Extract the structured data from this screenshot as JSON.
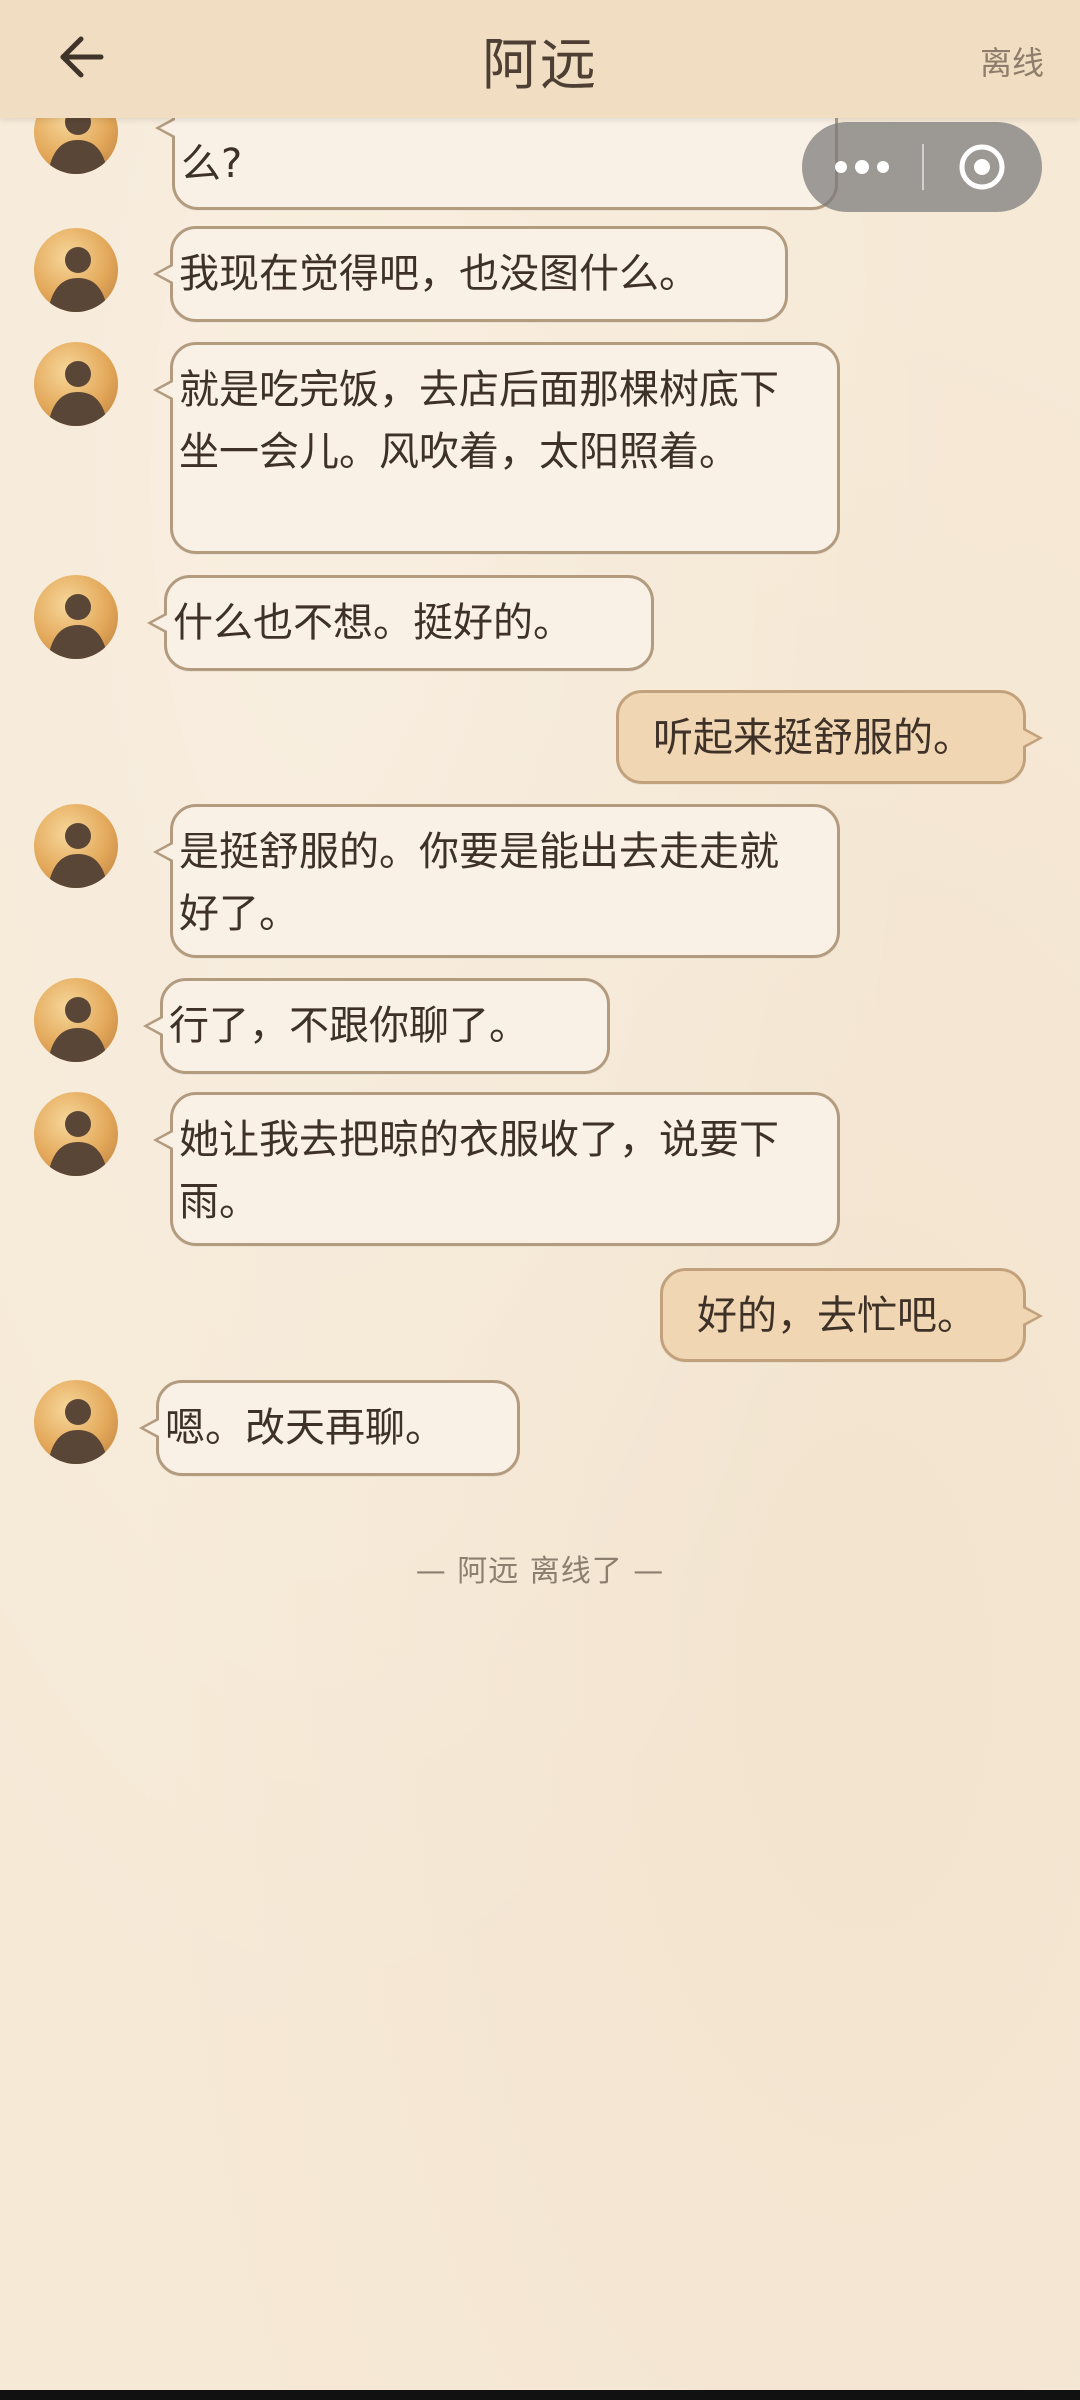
{
  "header": {
    "title": "阿远",
    "status": "离线"
  },
  "capsule": {
    "menu_icon": "more-dots-icon",
    "close_icon": "target-icon"
  },
  "messages": [
    {
      "side": "left",
      "text": "么?"
    },
    {
      "side": "left",
      "text": "我现在觉得吧，也没图什么。"
    },
    {
      "side": "left",
      "text": "就是吃完饭，去店后面那棵树底下坐一会儿。风吹着，太阳照着。"
    },
    {
      "side": "left",
      "text": "什么也不想。挺好的。"
    },
    {
      "side": "right",
      "text": "听起来挺舒服的。"
    },
    {
      "side": "left",
      "text": "是挺舒服的。你要是能出去走走就好了。"
    },
    {
      "side": "left",
      "text": "行了，不跟你聊了。"
    },
    {
      "side": "left",
      "text": "她让我去把晾的衣服收了，说要下雨。"
    },
    {
      "side": "right",
      "text": "好的，去忙吧。"
    },
    {
      "side": "left",
      "text": "嗯。改天再聊。"
    }
  ],
  "system_note": "— 阿远 离线了 —",
  "colors": {
    "background": "#f6e9d6",
    "header": "#f1ddc1",
    "left_bubble": "#f9f1e6",
    "right_bubble": "#f1d6b3",
    "bubble_border": "#b39b7f"
  }
}
